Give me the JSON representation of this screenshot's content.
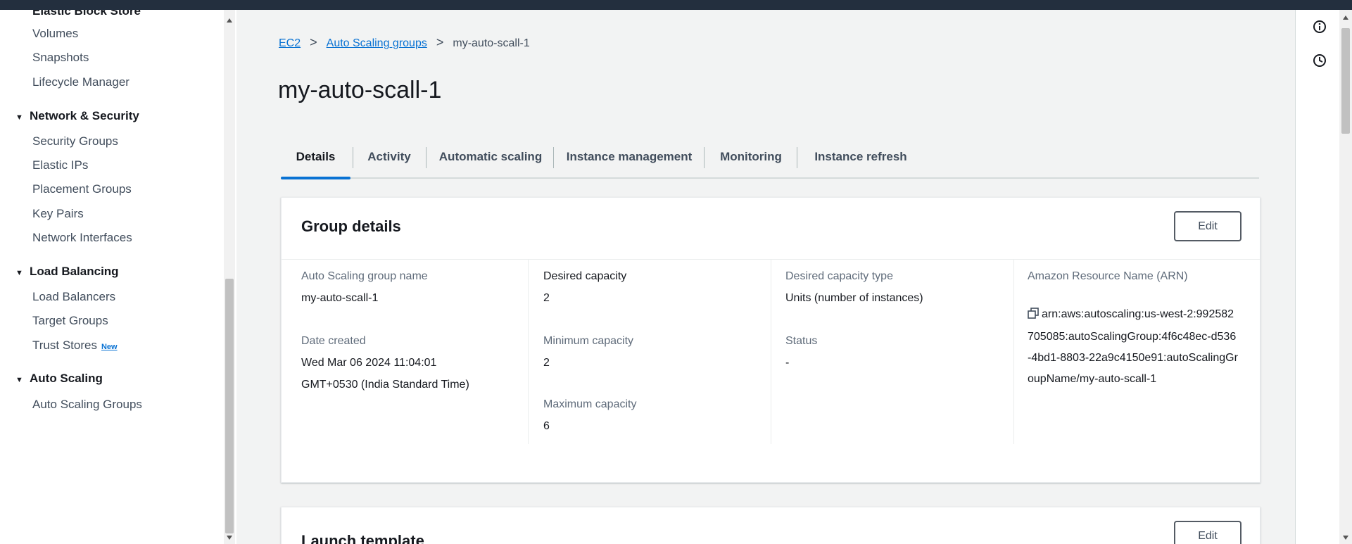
{
  "sidebar": {
    "cut_section": "Elastic Block Store",
    "ebs_items": [
      "Volumes",
      "Snapshots",
      "Lifecycle Manager"
    ],
    "sections": [
      {
        "title": "Network & Security",
        "items": [
          "Security Groups",
          "Elastic IPs",
          "Placement Groups",
          "Key Pairs",
          "Network Interfaces"
        ]
      },
      {
        "title": "Load Balancing",
        "items": [
          "Load Balancers",
          "Target Groups",
          "Trust Stores"
        ]
      },
      {
        "title": "Auto Scaling",
        "items": [
          "Auto Scaling Groups"
        ]
      }
    ],
    "new_badge": "New"
  },
  "breadcrumb": {
    "items": [
      "EC2",
      "Auto Scaling groups"
    ],
    "separator": ">",
    "current": "my-auto-scall-1"
  },
  "page_title": "my-auto-scall-1",
  "tabs": [
    "Details",
    "Activity",
    "Automatic scaling",
    "Instance management",
    "Monitoring",
    "Instance refresh"
  ],
  "active_tab": "Details",
  "group_details": {
    "title": "Group details",
    "edit_label": "Edit",
    "asg_name_label": "Auto Scaling group name",
    "asg_name_value": "my-auto-scall-1",
    "date_created_label": "Date created",
    "date_created_value_1": "Wed Mar 06 2024 11:04:01",
    "date_created_value_2": "GMT+0530 (India Standard Time)",
    "desired_capacity_label": "Desired capacity",
    "desired_capacity_value": "2",
    "min_capacity_label": "Minimum capacity",
    "min_capacity_value": "2",
    "max_capacity_label": "Maximum capacity",
    "max_capacity_value": "6",
    "desired_capacity_type_label": "Desired capacity type",
    "desired_capacity_type_value": "Units (number of instances)",
    "status_label": "Status",
    "status_value": "-",
    "arn_label": "Amazon Resource Name (ARN)",
    "arn_value": "arn:aws:autoscaling:us-west-2:992582705085:autoScalingGroup:4f6c48ec-d536-4bd1-8803-22a9c4150e91:autoScalingGroupName/my-auto-scall-1"
  },
  "launch_template": {
    "title": "Launch template",
    "edit_label": "Edit"
  },
  "colors": {
    "link": "#0972d3",
    "topbar": "#232f3e",
    "page_bg": "#f2f3f3",
    "text": "#16191f",
    "muted_text": "#5f6b7a"
  },
  "icons": {
    "rail_top": "info-circle-icon",
    "rail_bottom": "clock-history-icon",
    "arn_copy": "copy-icon"
  }
}
